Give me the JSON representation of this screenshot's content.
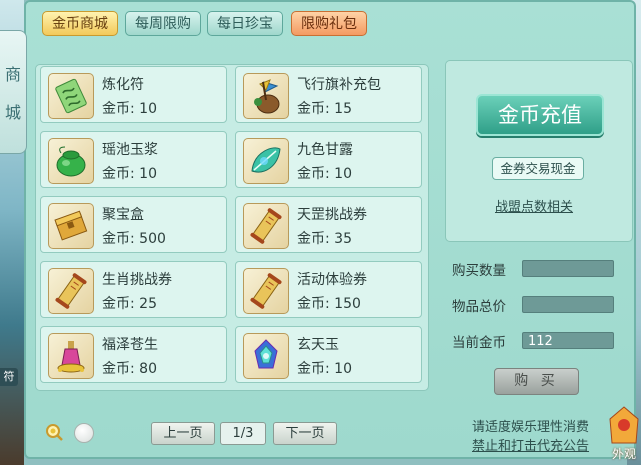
{
  "side": {
    "tab_chars": [
      "商",
      "城"
    ],
    "scrap_text": "符"
  },
  "tabs": [
    {
      "label": "金币商城",
      "active": true
    },
    {
      "label": "每周限购",
      "active": false
    },
    {
      "label": "每日珍宝",
      "active": false
    },
    {
      "label": "限购礼包",
      "active": false
    }
  ],
  "price_prefix": "金币: ",
  "items": [
    {
      "name": "炼化符",
      "price": "10",
      "icon": "talisman-icon"
    },
    {
      "name": "飞行旗补充包",
      "price": "15",
      "icon": "flag-pack-icon"
    },
    {
      "name": "瑶池玉浆",
      "price": "10",
      "icon": "jade-pot-icon"
    },
    {
      "name": "九色甘露",
      "price": "10",
      "icon": "nectar-leaf-icon"
    },
    {
      "name": "聚宝盒",
      "price": "500",
      "icon": "treasure-box-icon"
    },
    {
      "name": "天罡挑战券",
      "price": "35",
      "icon": "scroll-icon"
    },
    {
      "name": "生肖挑战券",
      "price": "25",
      "icon": "scroll-icon"
    },
    {
      "name": "活动体验券",
      "price": "150",
      "icon": "scroll-icon"
    },
    {
      "name": "福泽苍生",
      "price": "80",
      "icon": "potion-icon"
    },
    {
      "name": "玄天玉",
      "price": "10",
      "icon": "jade-gem-icon"
    }
  ],
  "side_panel": {
    "recharge_label": "金币充值",
    "exchange_label": "金券交易现金",
    "alliance_link": "战盟点数相关",
    "quantity_label": "购买数量",
    "quantity_value": "",
    "total_label": "物品总价",
    "total_value": "",
    "current_label": "当前金币",
    "current_value": "112",
    "buy_label": "购 买"
  },
  "pager": {
    "prev_label": "上一页",
    "page_text": "1/3",
    "next_label": "下一页"
  },
  "notice": {
    "line1": "请适度娱乐理性消费",
    "line2": "禁止和打击代充公告"
  },
  "corner": {
    "outer_look": "外观"
  },
  "colors": {
    "panel": "#a9e0d5",
    "accent_gold": "#f2c95a",
    "recharge": "#2f9f88"
  }
}
